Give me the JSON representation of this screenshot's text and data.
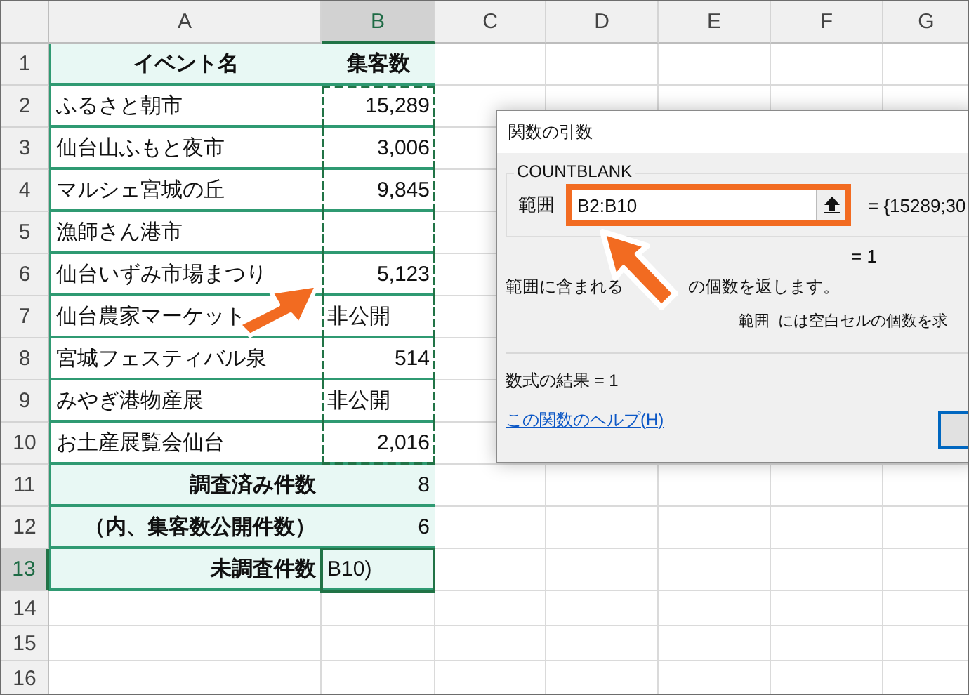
{
  "columns": [
    {
      "label": "A",
      "selected": false
    },
    {
      "label": "B",
      "selected": true
    },
    {
      "label": "C",
      "selected": false
    },
    {
      "label": "D",
      "selected": false
    },
    {
      "label": "E",
      "selected": false
    },
    {
      "label": "F",
      "selected": false
    },
    {
      "label": "G",
      "selected": false
    }
  ],
  "rows": [
    {
      "number": "1",
      "selected": false,
      "cells": [
        {
          "text": "イベント名",
          "kind": "header"
        },
        {
          "text": "集客数",
          "kind": "header"
        }
      ]
    },
    {
      "number": "2",
      "selected": false,
      "cells": [
        {
          "text": "ふるさと朝市",
          "kind": "text"
        },
        {
          "text": "15,289",
          "kind": "number",
          "referenced": true,
          "active": false
        }
      ]
    },
    {
      "number": "3",
      "selected": false,
      "cells": [
        {
          "text": "仙台山ふもと夜市",
          "kind": "text"
        },
        {
          "text": "3,006",
          "kind": "number",
          "referenced": true,
          "active": false
        }
      ]
    },
    {
      "number": "4",
      "selected": false,
      "cells": [
        {
          "text": "マルシェ宮城の丘",
          "kind": "text"
        },
        {
          "text": "9,845",
          "kind": "number",
          "referenced": true,
          "active": false
        }
      ]
    },
    {
      "number": "5",
      "selected": false,
      "cells": [
        {
          "text": "漁師さん港市",
          "kind": "text"
        },
        {
          "text": "",
          "kind": "number",
          "referenced": true,
          "active": false
        }
      ]
    },
    {
      "number": "6",
      "selected": false,
      "cells": [
        {
          "text": "仙台いずみ市場まつり",
          "kind": "text"
        },
        {
          "text": "5,123",
          "kind": "number",
          "referenced": true,
          "active": false
        }
      ]
    },
    {
      "number": "7",
      "selected": false,
      "cells": [
        {
          "text": "仙台農家マーケット",
          "kind": "text"
        },
        {
          "text": "非公開",
          "kind": "text",
          "referenced": true,
          "active": false
        }
      ]
    },
    {
      "number": "8",
      "selected": false,
      "cells": [
        {
          "text": "宮城フェスティバル泉",
          "kind": "text"
        },
        {
          "text": "514",
          "kind": "number",
          "referenced": true,
          "active": false
        }
      ]
    },
    {
      "number": "9",
      "selected": false,
      "cells": [
        {
          "text": "みやぎ港物産展",
          "kind": "text"
        },
        {
          "text": "非公開",
          "kind": "text",
          "referenced": true,
          "active": false
        }
      ]
    },
    {
      "number": "10",
      "selected": false,
      "cells": [
        {
          "text": "お土産展覧会仙台",
          "kind": "text"
        },
        {
          "text": "2,016",
          "kind": "number",
          "referenced": true,
          "active": false
        }
      ]
    },
    {
      "number": "11",
      "selected": false,
      "cells": [
        {
          "text": "調査済み件数",
          "kind": "summary"
        },
        {
          "text": "8",
          "kind": "summary_value",
          "referenced": false,
          "active": false
        }
      ]
    },
    {
      "number": "12",
      "selected": false,
      "cells": [
        {
          "text": "（内、集客数公開件数）",
          "kind": "summary"
        },
        {
          "text": "6",
          "kind": "summary_value",
          "referenced": false,
          "active": false
        }
      ]
    },
    {
      "number": "13",
      "selected": true,
      "cells": [
        {
          "text": "未調査件数",
          "kind": "summary"
        },
        {
          "text": "B10)",
          "kind": "editing",
          "referenced": false,
          "active": true
        }
      ]
    },
    {
      "number": "14",
      "selected": false,
      "cells": []
    },
    {
      "number": "15",
      "selected": false,
      "cells": []
    },
    {
      "number": "16",
      "selected": false,
      "cells": []
    }
  ],
  "dialog": {
    "title": "関数の引数",
    "function_name": "COUNTBLANK",
    "argument_label": "範囲",
    "argument_value": "B2:B10",
    "argument_preview": "=  {15289;30",
    "result_preview": "=  1",
    "description_parts": [
      "範囲に含まれる",
      "の個数を返します。"
    ],
    "argument_help_label": "範囲",
    "argument_help": "には空白セルの個数を求",
    "formula_result": "数式の結果 =  1",
    "help_link": "この関数のヘルプ(H)"
  }
}
